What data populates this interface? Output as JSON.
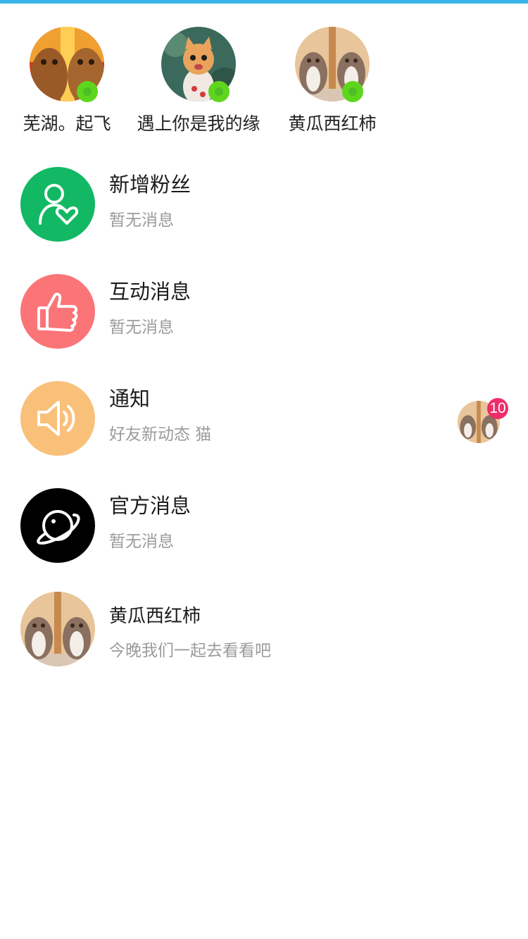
{
  "stories": [
    {
      "name": "芜湖。起飞",
      "avatar": "cat-pair-fire-avatar",
      "online": true
    },
    {
      "name": "遇上你是我的缘",
      "avatar": "cartoon-kitten-avatar",
      "online": true
    },
    {
      "name": "黄瓜西红柿",
      "avatar": "cat-pair-mirror-avatar",
      "online": true
    }
  ],
  "messages": [
    {
      "id": "new-fans",
      "title": "新增粉丝",
      "subtitle": "暂无消息",
      "icon": "user-heart-icon",
      "color": "#12b863"
    },
    {
      "id": "interactions",
      "title": "互动消息",
      "subtitle": "暂无消息",
      "icon": "thumbs-up-icon",
      "color": "#fb7477"
    },
    {
      "id": "notifications",
      "title": "通知",
      "subtitle": "好友新动态 猫",
      "icon": "speaker-icon",
      "color": "#f9c07a",
      "badge": "10"
    },
    {
      "id": "official",
      "title": "官方消息",
      "subtitle": "暂无消息",
      "icon": "planet-icon",
      "color": "#000000"
    },
    {
      "id": "chat-1",
      "title": "黄瓜西红柿",
      "subtitle": "今晚我们一起去看看吧",
      "icon": "cat-pair-mirror-avatar"
    }
  ],
  "colors": {
    "accent": "#35b4e8",
    "online": "#5fd61e",
    "badge": "#ee2d6a"
  }
}
